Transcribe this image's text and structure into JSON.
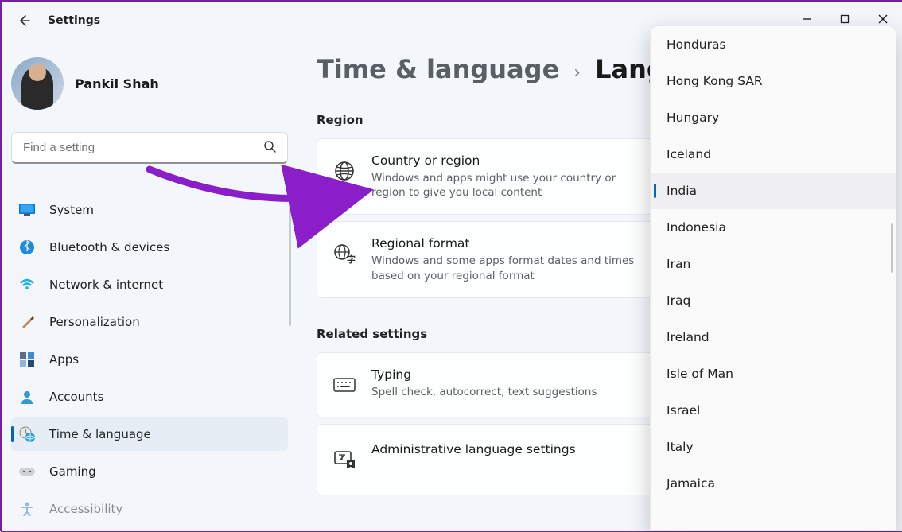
{
  "app_title": "Settings",
  "user": {
    "name": "Pankil Shah"
  },
  "search": {
    "placeholder": "Find a setting"
  },
  "nav": {
    "items": [
      {
        "label": "System",
        "icon": "monitor"
      },
      {
        "label": "Bluetooth & devices",
        "icon": "bluetooth"
      },
      {
        "label": "Network & internet",
        "icon": "wifi"
      },
      {
        "label": "Personalization",
        "icon": "brush"
      },
      {
        "label": "Apps",
        "icon": "grid"
      },
      {
        "label": "Accounts",
        "icon": "person"
      },
      {
        "label": "Time & language",
        "icon": "clock-globe",
        "selected": true
      },
      {
        "label": "Gaming",
        "icon": "gamepad"
      },
      {
        "label": "Accessibility",
        "icon": "accessibility"
      }
    ]
  },
  "breadcrumb": {
    "parent": "Time & language",
    "current": "Language & region"
  },
  "sections": {
    "region": {
      "title": "Region",
      "country_or_region": {
        "title": "Country or region",
        "desc": "Windows and apps might use your country or region to give you local content"
      },
      "regional_format": {
        "title": "Regional format",
        "desc": "Windows and some apps format dates and times based on your regional format"
      }
    },
    "related": {
      "title": "Related settings",
      "typing": {
        "title": "Typing",
        "desc": "Spell check, autocorrect, text suggestions"
      },
      "admin": {
        "title": "Administrative language settings"
      }
    }
  },
  "dropdown": {
    "items": [
      "Honduras",
      "Hong Kong SAR",
      "Hungary",
      "Iceland",
      "India",
      "Indonesia",
      "Iran",
      "Iraq",
      "Ireland",
      "Isle of Man",
      "Israel",
      "Italy",
      "Jamaica"
    ],
    "selected": "India"
  }
}
